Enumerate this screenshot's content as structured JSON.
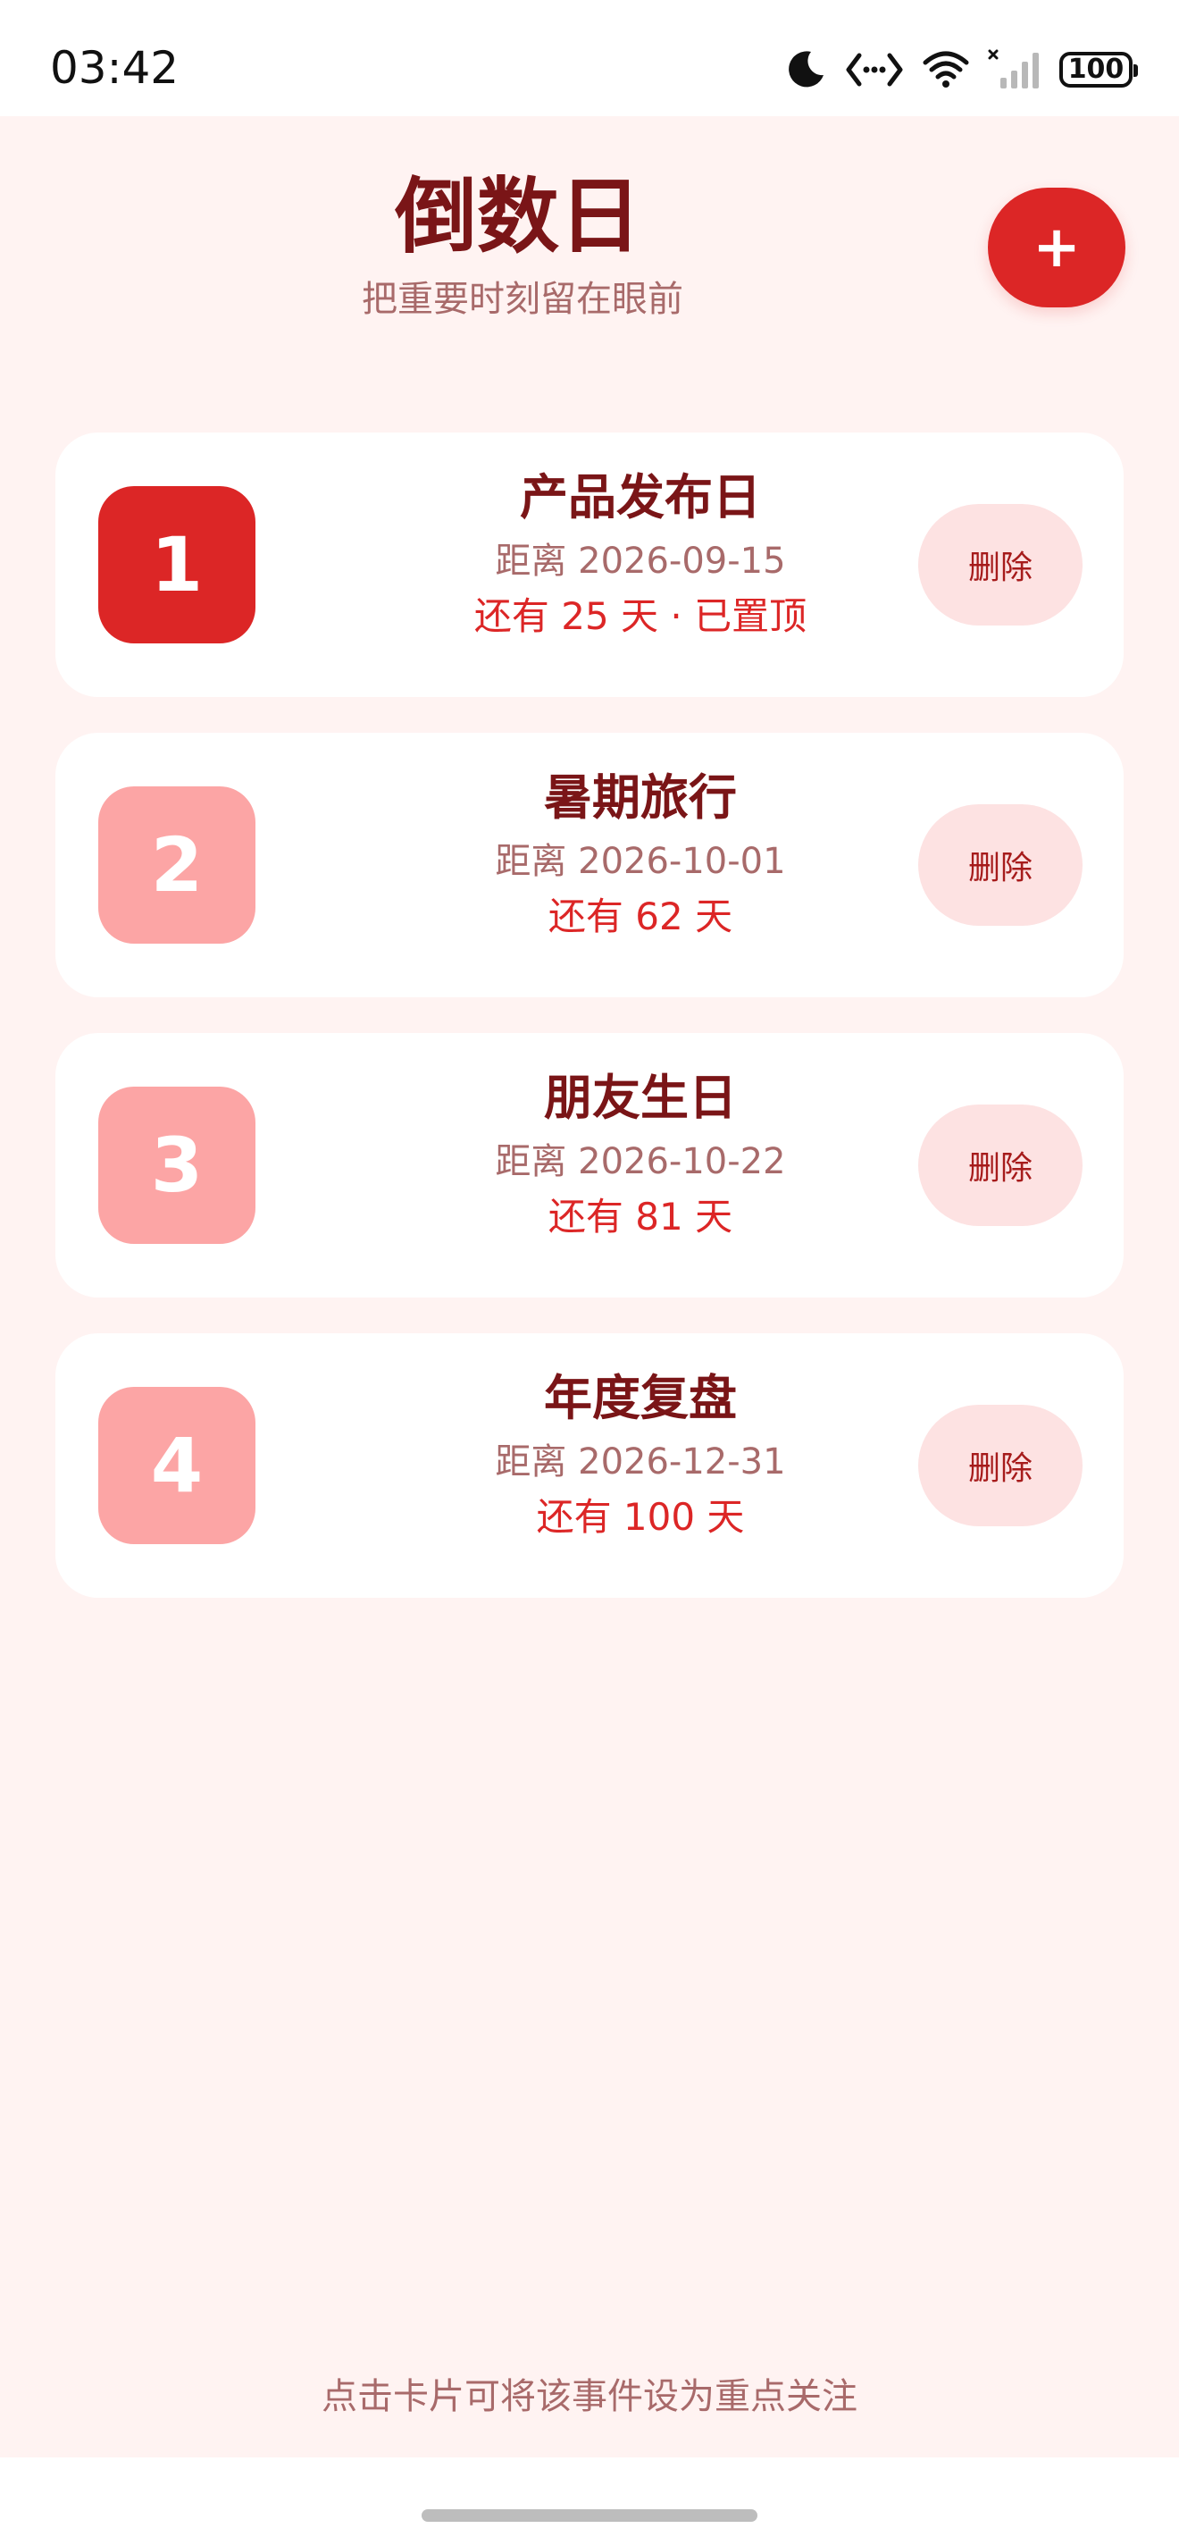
{
  "status_bar": {
    "time": "03:42",
    "battery": "100",
    "icons": [
      "moon-icon",
      "data-transfer-icon",
      "wifi-icon",
      "signal-icon",
      "battery-icon"
    ]
  },
  "header": {
    "title": "倒数日",
    "subtitle": "把重要时刻留在眼前",
    "add_label": "+"
  },
  "events": [
    {
      "rank": "1",
      "title": "产品发布日",
      "date": "距离 2026-09-15",
      "days": "还有 25 天 · 已置顶",
      "delete_label": "删除",
      "pinned": true
    },
    {
      "rank": "2",
      "title": "暑期旅行",
      "date": "距离 2026-10-01",
      "days": "还有 62 天",
      "delete_label": "删除",
      "pinned": false
    },
    {
      "rank": "3",
      "title": "朋友生日",
      "date": "距离 2026-10-22",
      "days": "还有 81 天",
      "delete_label": "删除",
      "pinned": false
    },
    {
      "rank": "4",
      "title": "年度复盘",
      "date": "距离 2026-12-31",
      "days": "还有 100 天",
      "delete_label": "删除",
      "pinned": false
    }
  ],
  "footer": {
    "hint": "点击卡片可将该事件设为重点关注"
  },
  "colors": {
    "accent": "#dc2626",
    "accent_light": "#fca5a5",
    "title": "#7a1517",
    "muted": "#a86a6a",
    "background": "#fff3f2",
    "delete_bg": "#fde2e2"
  }
}
